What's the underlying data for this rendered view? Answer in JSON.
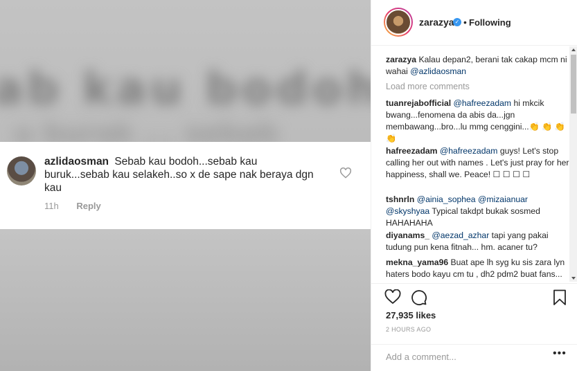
{
  "media": {
    "blurred_line1": "ab kau bodoh...seb",
    "blurred_line2": "u burak ... sebab"
  },
  "overlay_comment": {
    "username": "azlidaosman",
    "text": "Sebab kau bodoh...sebab  kau buruk...sebab kau selakeh..so x de sape nak beraya dgn kau",
    "time": "11h",
    "reply": "Reply"
  },
  "header": {
    "username": "zarazya",
    "separator": "•",
    "follow_status": "Following"
  },
  "comments": {
    "caption_user": "zarazya",
    "caption_text": "Kalau depan2, berani tak cakap mcm ni wahai",
    "caption_mention": "@azlidaosman",
    "load_more": "Load more comments",
    "items": [
      {
        "user": "tuanrejabofficial",
        "mention": "@hafreezadam",
        "text": "hi mkcik bwang...fenomena da abis da...jgn membawang...bro...lu mmg cenggini...👏 👏 👏 👏"
      },
      {
        "user": "hafreezadam",
        "mention": "@hafreezadam",
        "text": "guys! Let's stop calling her out with names . Let's just pray for her happiness, shall we. Peace! ☐ ☐ ☐ ☐"
      },
      {
        "user": "tshnrln",
        "mention": "@ainia_sophea @mizaianuar @skyshyaa",
        "text": "Typical takdpt bukak sosmed HAHAHAHA"
      },
      {
        "user": "diyanams_",
        "mention": "@aezad_azhar",
        "text": "tapi yang pakai tudung pun kena fitnah... hm. acaner tu?"
      },
      {
        "user": "mekna_yama96",
        "mention": "",
        "text": "Buat ape lh syg ku sis zara lyn haters bodo kayu cm tu , dh2 pdm2 buat fans..."
      }
    ]
  },
  "actions": {
    "likes": "27,935 likes",
    "time": "2 HOURS AGO"
  },
  "add_comment": {
    "placeholder": "Add a comment...",
    "more": "•••"
  }
}
